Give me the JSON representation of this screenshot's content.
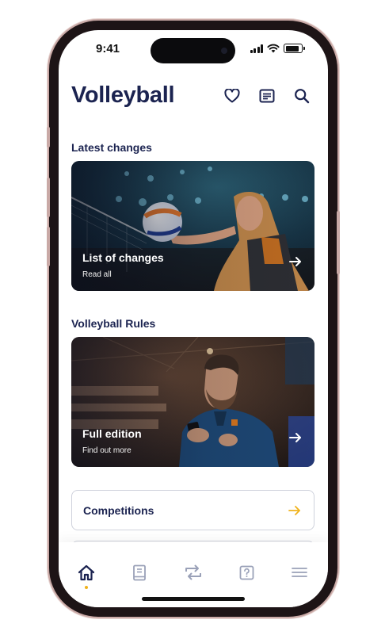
{
  "status": {
    "time": "9:41",
    "battery_level": 0.85
  },
  "header": {
    "title": "Volleyball",
    "icons": [
      "heart-icon",
      "news-icon",
      "search-icon"
    ]
  },
  "sections": {
    "latest": {
      "label": "Latest changes",
      "card": {
        "title": "List of changes",
        "subtitle": "Read all"
      }
    },
    "rules": {
      "label": "Volleyball Rules",
      "card": {
        "title": "Full edition",
        "subtitle": "Find out more"
      }
    }
  },
  "list": [
    {
      "label": "Competitions"
    }
  ],
  "tabbar": {
    "items": [
      "home-icon",
      "book-icon",
      "repeat-icon",
      "help-icon",
      "menu-icon"
    ],
    "active": 0
  },
  "colors": {
    "navy": "#1b2350",
    "accent": "#f0b21b",
    "tab_inactive": "#9aa1b8"
  }
}
